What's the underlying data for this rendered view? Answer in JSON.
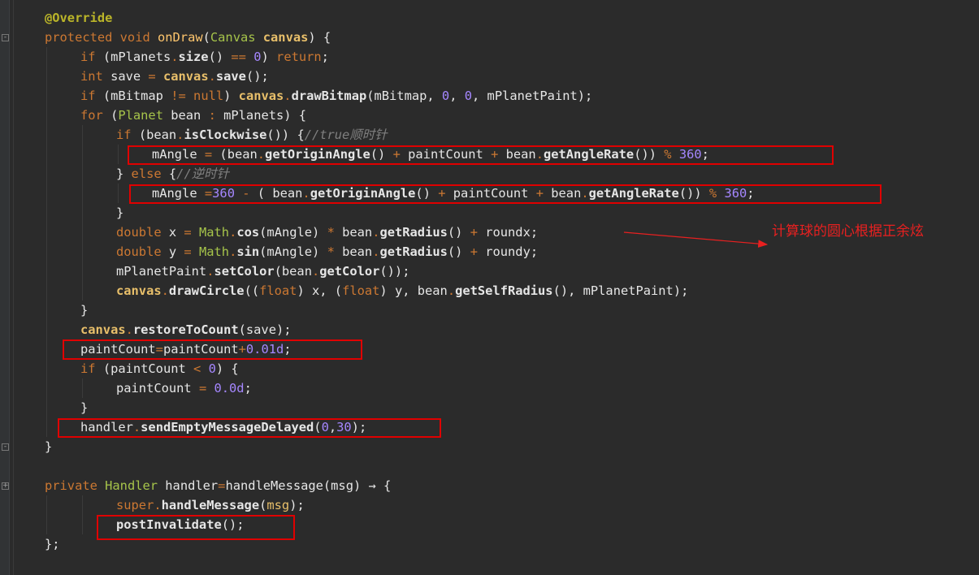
{
  "code_lines": [
    {
      "indent": 0,
      "tokens": [
        [
          "ann b",
          "@Override"
        ]
      ]
    },
    {
      "indent": 0,
      "tokens": [
        [
          "kw",
          "protected void "
        ],
        [
          "fn",
          "onDraw"
        ],
        [
          "",
          "("
        ],
        [
          "typ",
          "Canvas "
        ],
        [
          "param b",
          "canvas"
        ],
        [
          "",
          ") {"
        ]
      ]
    },
    {
      "indent": 1,
      "tokens": [
        [
          "kw",
          "if "
        ],
        [
          "",
          "(mPlanets"
        ],
        [
          "op",
          "."
        ],
        [
          "b",
          "size"
        ],
        [
          "",
          "() "
        ],
        [
          "op",
          "=="
        ],
        [
          "",
          " "
        ],
        [
          "num",
          "0"
        ],
        [
          "",
          ") "
        ],
        [
          "kw",
          "return"
        ],
        [
          "",
          ";"
        ]
      ]
    },
    {
      "indent": 1,
      "tokens": [
        [
          "kw",
          "int "
        ],
        [
          "",
          "save "
        ],
        [
          "op",
          "="
        ],
        [
          "",
          " "
        ],
        [
          "param b",
          "canvas"
        ],
        [
          "op",
          "."
        ],
        [
          "b",
          "save"
        ],
        [
          "",
          "();"
        ]
      ]
    },
    {
      "indent": 1,
      "tokens": [
        [
          "kw",
          "if "
        ],
        [
          "",
          "(mBitmap "
        ],
        [
          "op",
          "!="
        ],
        [
          "",
          " "
        ],
        [
          "kw",
          "null"
        ],
        [
          "",
          ") "
        ],
        [
          "param b",
          "canvas"
        ],
        [
          "op",
          "."
        ],
        [
          "b",
          "drawBitmap"
        ],
        [
          "",
          "(mBitmap, "
        ],
        [
          "num",
          "0"
        ],
        [
          "",
          ", "
        ],
        [
          "num",
          "0"
        ],
        [
          "",
          ", mPlanetPaint);"
        ]
      ]
    },
    {
      "indent": 1,
      "tokens": [
        [
          "kw",
          "for "
        ],
        [
          "",
          "("
        ],
        [
          "typ",
          "Planet "
        ],
        [
          "",
          "bean "
        ],
        [
          "op",
          ":"
        ],
        [
          "",
          " mPlanets) {"
        ]
      ]
    },
    {
      "indent": 2,
      "tokens": [
        [
          "kw",
          "if "
        ],
        [
          "",
          "(bean"
        ],
        [
          "op",
          "."
        ],
        [
          "b",
          "isClockwise"
        ],
        [
          "",
          "()) {"
        ],
        [
          "cm",
          "//true顺时针"
        ]
      ]
    },
    {
      "indent": 3,
      "tokens": [
        [
          "",
          "mAngle "
        ],
        [
          "op",
          "="
        ],
        [
          "",
          " (bean"
        ],
        [
          "op",
          "."
        ],
        [
          "b",
          "getOriginAngle"
        ],
        [
          "",
          "() "
        ],
        [
          "op",
          "+"
        ],
        [
          "",
          " paintCount "
        ],
        [
          "op",
          "+"
        ],
        [
          "",
          " bean"
        ],
        [
          "op",
          "."
        ],
        [
          "b",
          "getAngleRate"
        ],
        [
          "",
          "()) "
        ],
        [
          "op",
          "%"
        ],
        [
          "",
          " "
        ],
        [
          "num",
          "360"
        ],
        [
          "",
          ";"
        ]
      ]
    },
    {
      "indent": 2,
      "tokens": [
        [
          "",
          "} "
        ],
        [
          "kw",
          "else "
        ],
        [
          "",
          "{"
        ],
        [
          "cm",
          "//逆时针"
        ]
      ]
    },
    {
      "indent": 3,
      "tokens": [
        [
          "",
          "mAngle "
        ],
        [
          "op",
          "="
        ],
        [
          "num",
          "360"
        ],
        [
          "",
          " "
        ],
        [
          "op",
          "-"
        ],
        [
          "",
          " ( bean"
        ],
        [
          "op",
          "."
        ],
        [
          "b",
          "getOriginAngle"
        ],
        [
          "",
          "() "
        ],
        [
          "op",
          "+"
        ],
        [
          "",
          " paintCount "
        ],
        [
          "op",
          "+"
        ],
        [
          "",
          " bean"
        ],
        [
          "op",
          "."
        ],
        [
          "b",
          "getAngleRate"
        ],
        [
          "",
          "()) "
        ],
        [
          "op",
          "%"
        ],
        [
          "",
          " "
        ],
        [
          "num",
          "360"
        ],
        [
          "",
          ";"
        ]
      ]
    },
    {
      "indent": 2,
      "tokens": [
        [
          "",
          "}"
        ]
      ]
    },
    {
      "indent": 2,
      "tokens": [
        [
          "kw",
          "double "
        ],
        [
          "",
          "x "
        ],
        [
          "op",
          "="
        ],
        [
          "",
          " "
        ],
        [
          "typ",
          "Math"
        ],
        [
          "op",
          "."
        ],
        [
          "b",
          "cos"
        ],
        [
          "",
          "(mAngle) "
        ],
        [
          "op",
          "*"
        ],
        [
          "",
          " bean"
        ],
        [
          "op",
          "."
        ],
        [
          "b",
          "getRadius"
        ],
        [
          "",
          "() "
        ],
        [
          "op",
          "+"
        ],
        [
          "",
          " roundx;"
        ]
      ]
    },
    {
      "indent": 2,
      "tokens": [
        [
          "kw",
          "double "
        ],
        [
          "",
          "y "
        ],
        [
          "op",
          "="
        ],
        [
          "",
          " "
        ],
        [
          "typ",
          "Math"
        ],
        [
          "op",
          "."
        ],
        [
          "b",
          "sin"
        ],
        [
          "",
          "(mAngle) "
        ],
        [
          "op",
          "*"
        ],
        [
          "",
          " bean"
        ],
        [
          "op",
          "."
        ],
        [
          "b",
          "getRadius"
        ],
        [
          "",
          "() "
        ],
        [
          "op",
          "+"
        ],
        [
          "",
          " roundy;"
        ]
      ]
    },
    {
      "indent": 2,
      "tokens": [
        [
          "",
          "mPlanetPaint"
        ],
        [
          "op",
          "."
        ],
        [
          "b",
          "setColor"
        ],
        [
          "",
          "(bean"
        ],
        [
          "op",
          "."
        ],
        [
          "b",
          "getColor"
        ],
        [
          "",
          "());"
        ]
      ]
    },
    {
      "indent": 2,
      "tokens": [
        [
          "param b",
          "canvas"
        ],
        [
          "op",
          "."
        ],
        [
          "b",
          "drawCircle"
        ],
        [
          "",
          "(("
        ],
        [
          "kw",
          "float"
        ],
        [
          "",
          ") x, ("
        ],
        [
          "kw",
          "float"
        ],
        [
          "",
          ") y, bean"
        ],
        [
          "op",
          "."
        ],
        [
          "b",
          "getSelfRadius"
        ],
        [
          "",
          "(), mPlanetPaint);"
        ]
      ]
    },
    {
      "indent": 1,
      "tokens": [
        [
          "",
          "}"
        ]
      ]
    },
    {
      "indent": 1,
      "tokens": [
        [
          "param b",
          "canvas"
        ],
        [
          "op",
          "."
        ],
        [
          "b",
          "restoreToCount"
        ],
        [
          "",
          "(save);"
        ]
      ]
    },
    {
      "indent": 1,
      "tokens": [
        [
          "",
          "paintCount"
        ],
        [
          "op",
          "="
        ],
        [
          "",
          "paintCount"
        ],
        [
          "op",
          "+"
        ],
        [
          "num",
          "0.01d"
        ],
        [
          "",
          ";"
        ]
      ]
    },
    {
      "indent": 1,
      "tokens": [
        [
          "kw",
          "if "
        ],
        [
          "",
          "(paintCount "
        ],
        [
          "op",
          "<"
        ],
        [
          "",
          " "
        ],
        [
          "num",
          "0"
        ],
        [
          "",
          ") {"
        ]
      ]
    },
    {
      "indent": 2,
      "tokens": [
        [
          "",
          "paintCount "
        ],
        [
          "op",
          "="
        ],
        [
          "",
          " "
        ],
        [
          "num",
          "0.0d"
        ],
        [
          "",
          ";"
        ]
      ]
    },
    {
      "indent": 1,
      "tokens": [
        [
          "",
          "}"
        ]
      ]
    },
    {
      "indent": 1,
      "tokens": [
        [
          "",
          "handler"
        ],
        [
          "op",
          "."
        ],
        [
          "b",
          "sendEmptyMessageDelayed"
        ],
        [
          "",
          "("
        ],
        [
          "num",
          "0"
        ],
        [
          "",
          ","
        ],
        [
          "num",
          "30"
        ],
        [
          "",
          ");"
        ]
      ]
    },
    {
      "indent": 0,
      "tokens": [
        [
          "",
          "}"
        ]
      ]
    },
    {
      "indent": 0,
      "tokens": []
    },
    {
      "indent": 0,
      "tokens": [
        [
          "kw",
          "private "
        ],
        [
          "typ",
          "Handler "
        ],
        [
          "",
          "handler"
        ],
        [
          "op",
          "="
        ],
        [
          "",
          "handleMessage(msg) → {"
        ]
      ]
    },
    {
      "indent": 2,
      "tokens": [
        [
          "kw",
          "super"
        ],
        [
          "op",
          "."
        ],
        [
          "b",
          "handleMessage"
        ],
        [
          "",
          "("
        ],
        [
          "param",
          "msg"
        ],
        [
          "",
          ");"
        ]
      ]
    },
    {
      "indent": 2,
      "tokens": [
        [
          "b",
          "postInvalidate"
        ],
        [
          "",
          "();"
        ]
      ]
    },
    {
      "indent": 0,
      "tokens": [
        [
          "",
          "};"
        ]
      ]
    }
  ],
  "annotation_note": "计算球的圆心根据正余炫",
  "colors": {
    "background": "#2b2b2b",
    "highlight_box": "#e00000",
    "annotation": "#e82020"
  }
}
